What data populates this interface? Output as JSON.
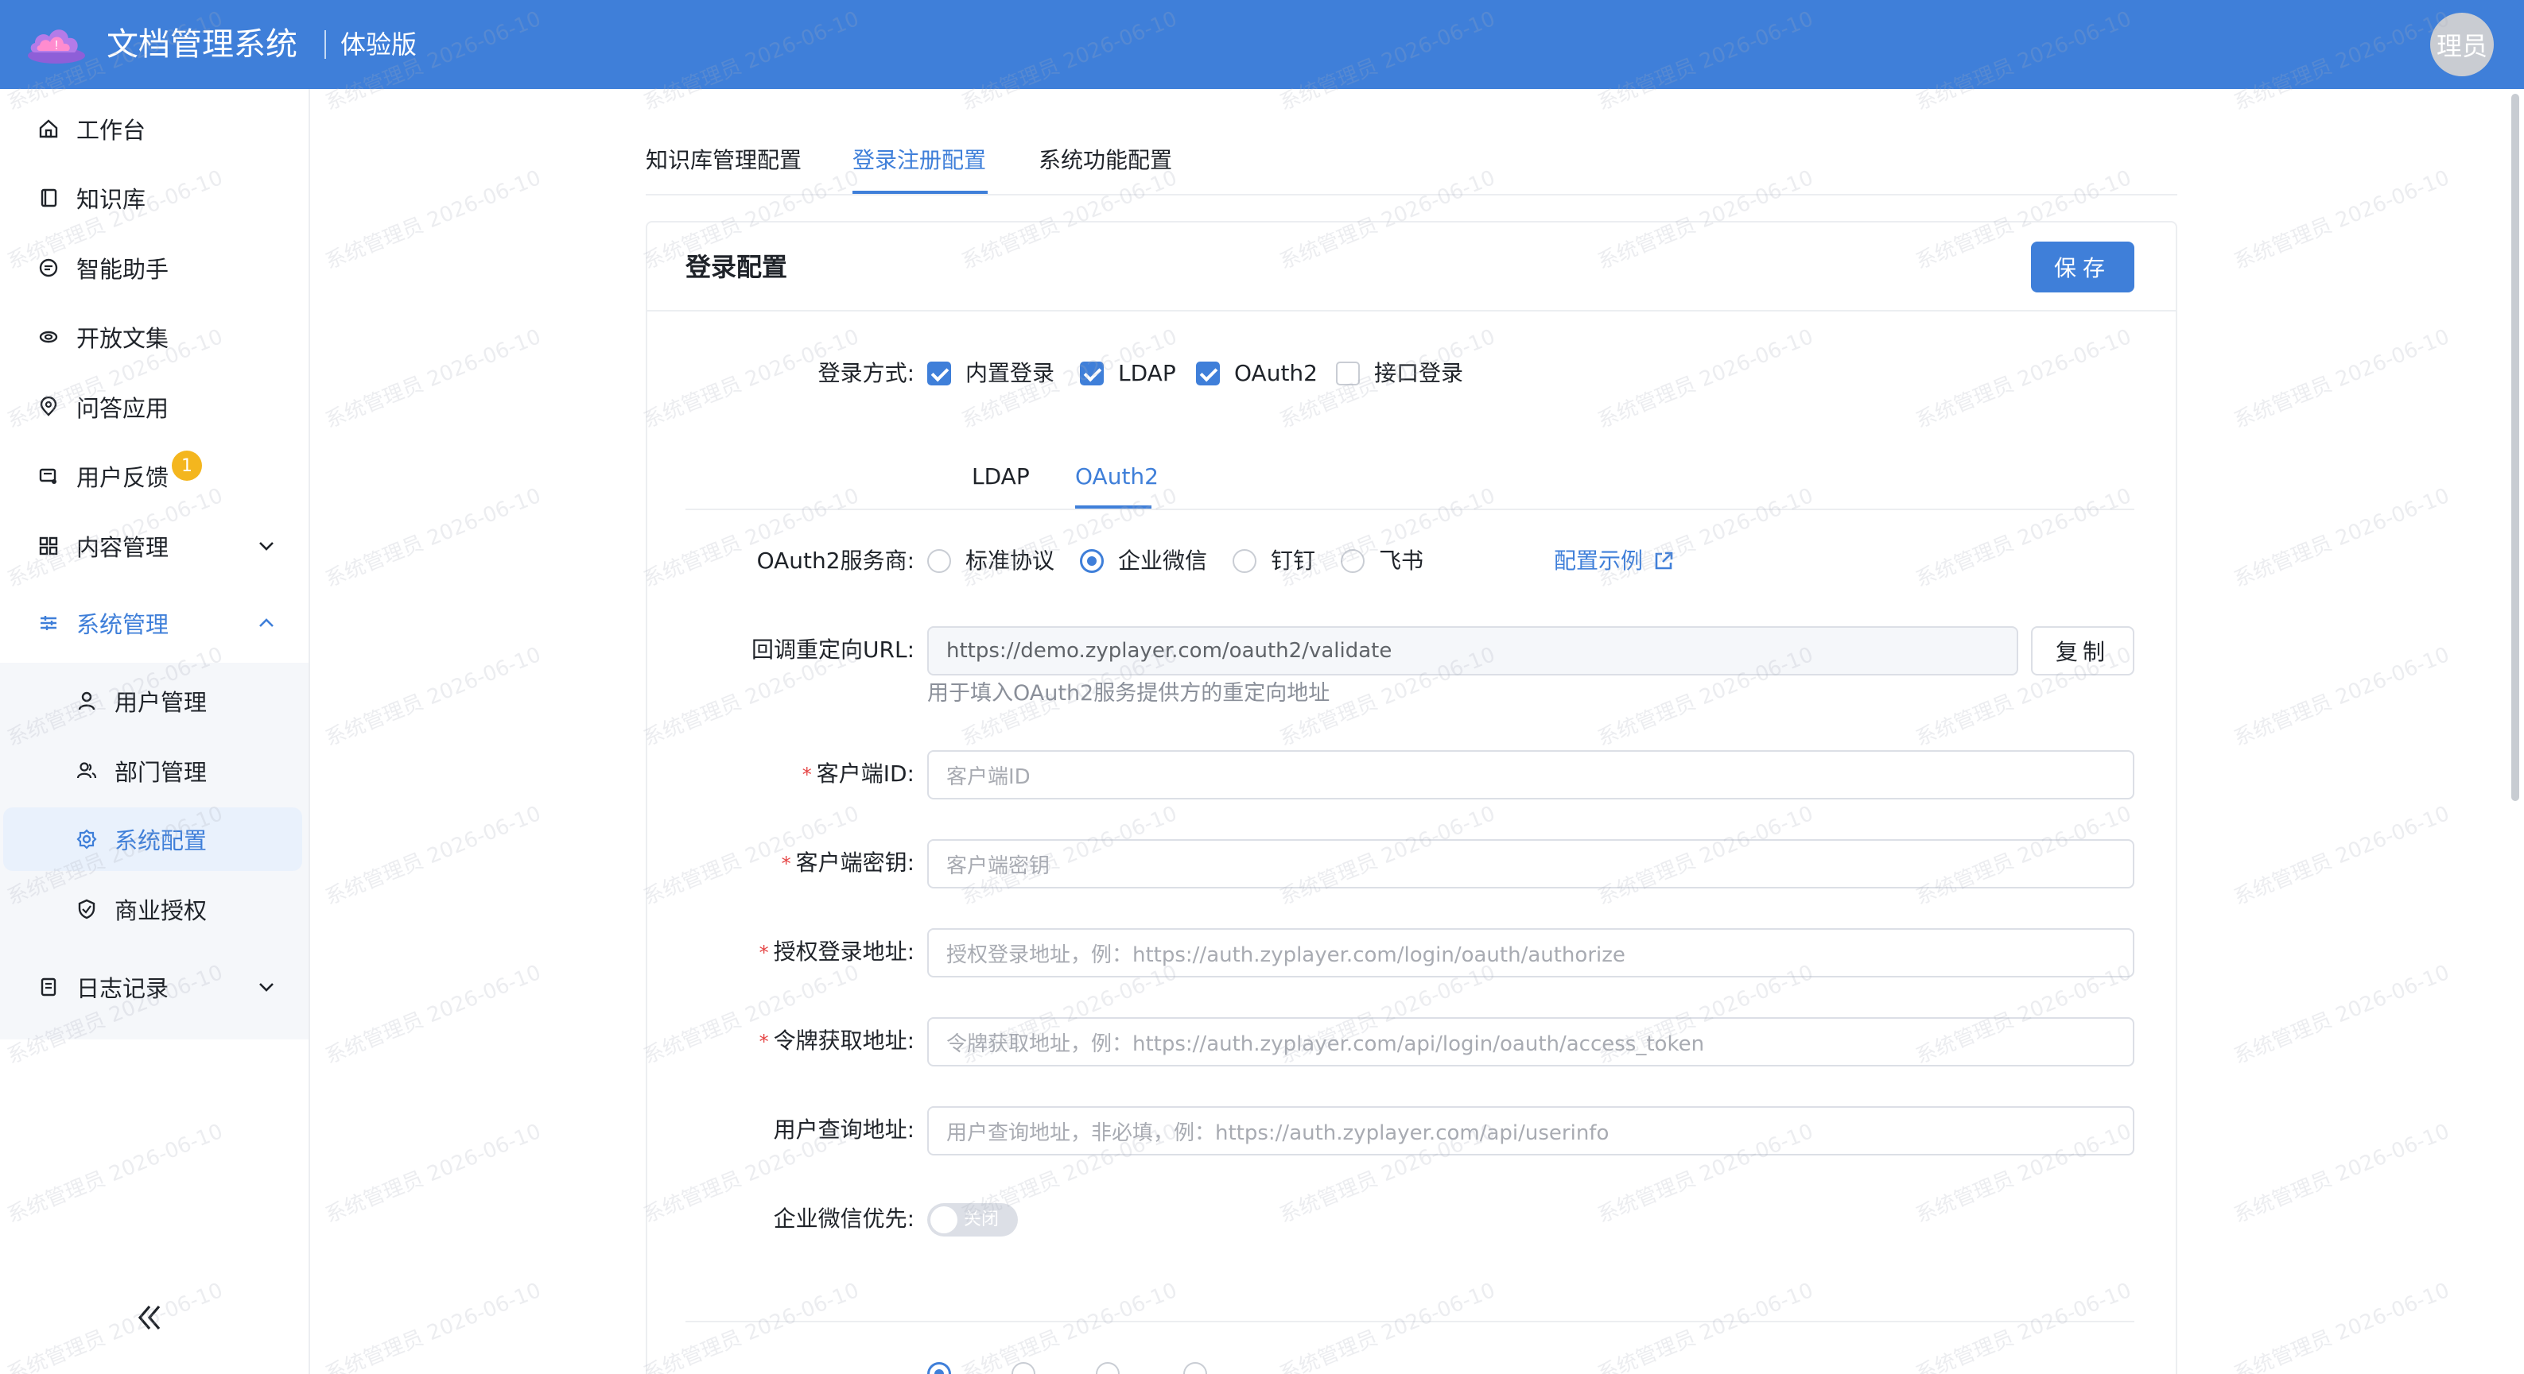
{
  "header": {
    "app_title": "文档管理系统",
    "edition": "体验版",
    "avatar_text": "理员",
    "brand_color": "#3f7fd9"
  },
  "sidebar": {
    "items": [
      {
        "label": "工作台",
        "icon": "home-icon"
      },
      {
        "label": "知识库",
        "icon": "book-icon"
      },
      {
        "label": "智能助手",
        "icon": "chat-icon"
      },
      {
        "label": "开放文集",
        "icon": "open-collection-icon"
      },
      {
        "label": "问答应用",
        "icon": "qa-app-icon"
      },
      {
        "label": "用户反馈",
        "icon": "feedback-icon",
        "badge": "1"
      },
      {
        "label": "内容管理",
        "icon": "grid-icon",
        "expandable": true
      },
      {
        "label": "系统管理",
        "icon": "settings-sliders-icon",
        "expanded": true
      },
      {
        "label": "日志记录",
        "icon": "log-icon",
        "expandable": true
      }
    ],
    "sub_items": [
      {
        "label": "用户管理",
        "icon": "user-icon"
      },
      {
        "label": "部门管理",
        "icon": "department-icon"
      },
      {
        "label": "系统配置",
        "icon": "gear-icon",
        "selected": true
      },
      {
        "label": "商业授权",
        "icon": "shield-icon"
      }
    ]
  },
  "tabs": [
    {
      "label": "知识库管理配置"
    },
    {
      "label": "登录注册配置",
      "active": true
    },
    {
      "label": "系统功能配置"
    }
  ],
  "card": {
    "title": "登录配置",
    "save_label": "保存"
  },
  "login_methods": {
    "label": "登录方式:",
    "options": [
      {
        "label": "内置登录",
        "checked": true
      },
      {
        "label": "LDAP",
        "checked": true
      },
      {
        "label": "OAuth2",
        "checked": true
      },
      {
        "label": "接口登录",
        "checked": false
      }
    ]
  },
  "inner_tabs": [
    {
      "label": "LDAP"
    },
    {
      "label": "OAuth2",
      "active": true
    }
  ],
  "oauth": {
    "provider_label": "OAuth2服务商:",
    "providers": [
      {
        "label": "标准协议",
        "checked": false
      },
      {
        "label": "企业微信",
        "checked": true
      },
      {
        "label": "钉钉",
        "checked": false
      },
      {
        "label": "飞书",
        "checked": false
      }
    ],
    "example_link": "配置示例",
    "callback_label": "回调重定向URL:",
    "callback_value": "https://demo.zyplayer.com/oauth2/validate",
    "copy_label": "复制",
    "callback_help": "用于填入OAuth2服务提供方的重定向地址",
    "client_id_label": "客户端ID:",
    "client_id_placeholder": "客户端ID",
    "client_secret_label": "客户端密钥:",
    "client_secret_placeholder": "客户端密钥",
    "auth_url_label": "授权登录地址:",
    "auth_url_placeholder": "授权登录地址，例：https://auth.zyplayer.com/login/oauth/authorize",
    "token_url_label": "令牌获取地址:",
    "token_url_placeholder": "令牌获取地址，例：https://auth.zyplayer.com/api/login/oauth/access_token",
    "userinfo_url_label": "用户查询地址:",
    "userinfo_url_placeholder": "用户查询地址，非必填，例：https://auth.zyplayer.com/api/userinfo",
    "wecom_priority_label": "企业微信优先:",
    "wecom_priority_switch": "关闭",
    "wecom_priority_on": false
  },
  "watermark": {
    "line1": "系统管理员",
    "line2": "2026-06-10"
  }
}
